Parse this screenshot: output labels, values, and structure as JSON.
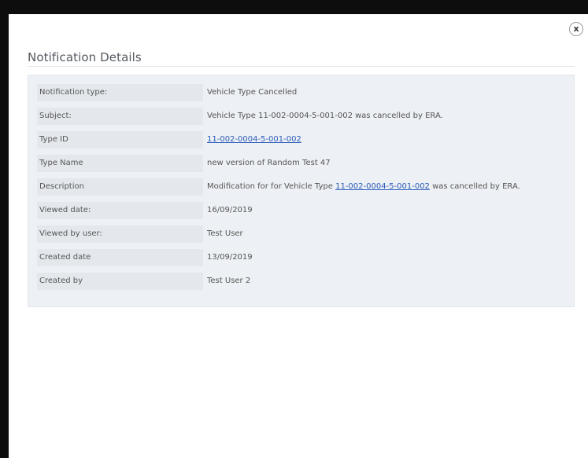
{
  "dialog": {
    "title": "Notification Details",
    "close_label": "x"
  },
  "details": [
    {
      "label": "Notification type:",
      "value": "Vehicle Type Cancelled"
    },
    {
      "label": "Subject:",
      "value": "Vehicle Type 11-002-0004-5-001-002 was cancelled by ERA."
    },
    {
      "label": "Type ID",
      "link": "11-002-0004-5-001-002"
    },
    {
      "label": "Type Name",
      "value": "new version of Random Test 47"
    },
    {
      "label": "Description",
      "value_prefix": "Modification for for Vehicle Type ",
      "link": "11-002-0004-5-001-002",
      "value_suffix": " was cancelled by ERA."
    },
    {
      "label": "Viewed date:",
      "value": "16/09/2019"
    },
    {
      "label": "Viewed by user:",
      "value": "Test User"
    },
    {
      "label": "Created date",
      "value": "13/09/2019"
    },
    {
      "label": "Created by",
      "value": "Test User 2"
    }
  ],
  "colors": {
    "link": "#2a5cb8",
    "panel_background": "#edf0f4",
    "label_background": "#e4e8ed"
  }
}
